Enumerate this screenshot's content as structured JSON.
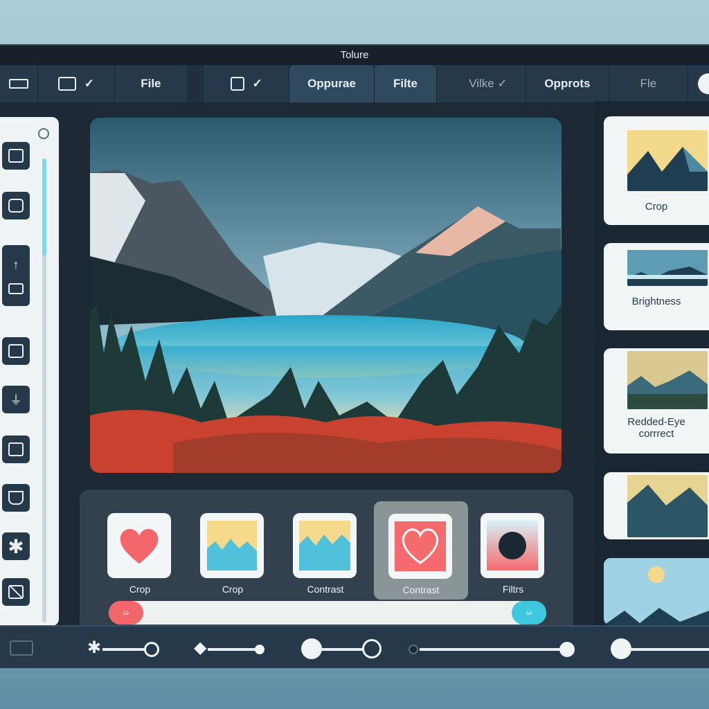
{
  "window": {
    "title": "Tolure"
  },
  "toolbar": {
    "items": [
      {
        "label": "",
        "icon": "battery-icon"
      },
      {
        "label": "",
        "icon": "image-check-icon"
      },
      {
        "label": "File"
      },
      {
        "label": "",
        "icon": "frame-check-icon"
      },
      {
        "label": "Oppurae",
        "active": true
      },
      {
        "label": "Filte",
        "active": true
      },
      {
        "label": "Vilke ✓"
      },
      {
        "label": "Opprots"
      },
      {
        "label": "Fle"
      }
    ]
  },
  "left_tools": [
    "square-icon",
    "camera-icon",
    "upload-icon",
    "frame-icon",
    "square-icon",
    "anchor-icon",
    "folder-icon",
    "bucket-icon",
    "asterisk-icon",
    "crop-slash-icon"
  ],
  "tools": {
    "items": [
      {
        "label": "Crop",
        "icon": "heart-icon"
      },
      {
        "label": "Crop",
        "icon": "mountain-icon"
      },
      {
        "label": "Contrast",
        "icon": "mountain-icon"
      },
      {
        "label": "Contrast",
        "icon": "heart-outline-icon",
        "selected": true
      },
      {
        "label": "Filtrs",
        "icon": "circle-icon"
      }
    ],
    "range": {
      "min_label": "ω",
      "max_label": "ω"
    }
  },
  "right_panel": {
    "items": [
      {
        "label": "Crop"
      },
      {
        "label": "Brightness"
      },
      {
        "label": "Redded-Eye",
        "label2": "corrrect"
      },
      {
        "label": ""
      },
      {
        "label": ""
      }
    ]
  },
  "colors": {
    "accent_red": "#f2666a",
    "accent_cyan": "#3ec8de",
    "panel": "#26394a"
  }
}
